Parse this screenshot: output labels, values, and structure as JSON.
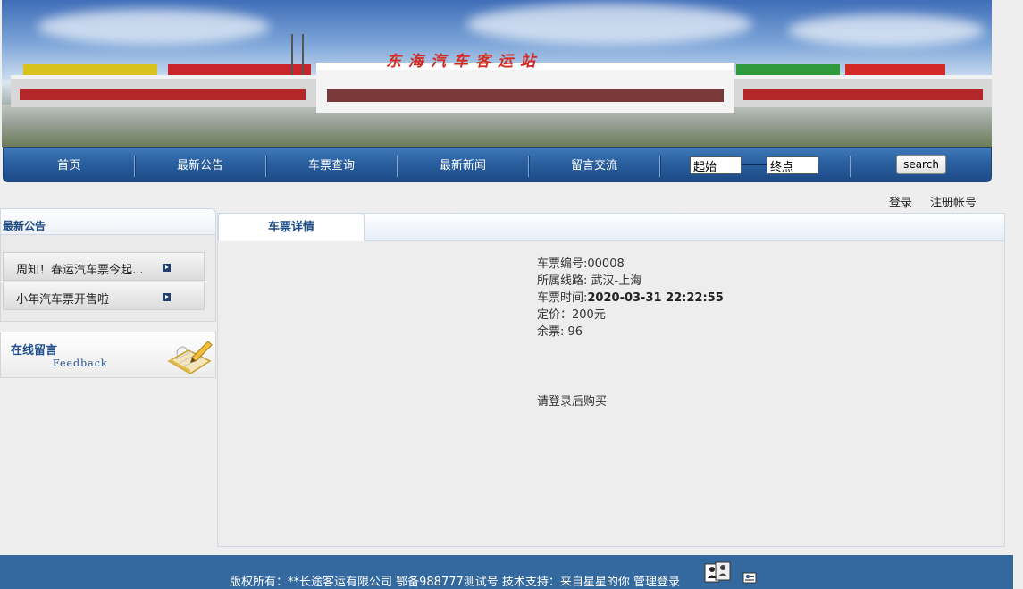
{
  "banner": {
    "title": "东海汽车客运站"
  },
  "nav": {
    "items": [
      {
        "label": "首页"
      },
      {
        "label": "最新公告"
      },
      {
        "label": "车票查询"
      },
      {
        "label": "最新新闻"
      },
      {
        "label": "留言交流"
      }
    ],
    "start_value": "起始",
    "end_value": "终点",
    "search_label": "search"
  },
  "auth": {
    "login": "登录",
    "register": "注册帐号"
  },
  "sidebar": {
    "notice_title": "最新公告",
    "notices": [
      {
        "label": "周知！春运汽车票今起..."
      },
      {
        "label": "小年汽车票开售啦"
      }
    ],
    "feedback_title": "在线留言",
    "feedback_sub": "Feedback"
  },
  "main": {
    "tab_label": "车票详情",
    "ticket_no": "车票编号:00008",
    "route": "所属线路: 武汉-上海",
    "time_label": "车票时间:",
    "time_value": "2020-03-31 22:22:55",
    "price": "定价：200元",
    "remaining": "余票: 96",
    "login_hint": "请登录后购买"
  },
  "footer": {
    "text": "版权所有：**长途客运有限公司   鄂备988777测试号  技术支持：来自星星的你  ",
    "admin_login": "管理登录"
  },
  "colors": {
    "nav_blue": "#2a5f9f",
    "footer_blue": "#33699e",
    "heading_blue": "#1e4c86"
  }
}
